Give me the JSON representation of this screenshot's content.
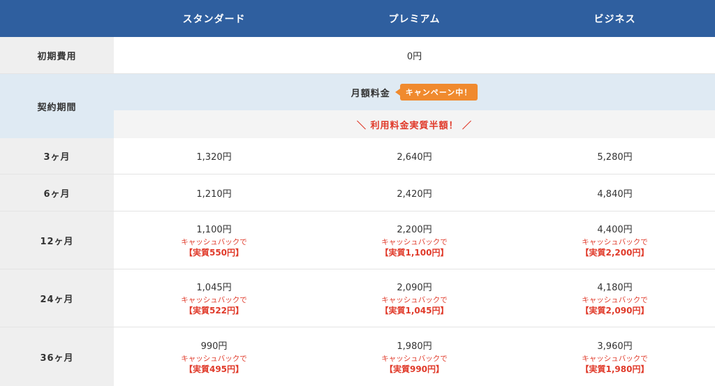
{
  "header": {
    "plans": [
      "スタンダード",
      "プレミアム",
      "ビジネス"
    ]
  },
  "initial_fee": {
    "label": "初期費用",
    "value": "0円"
  },
  "contract": {
    "label": "契約期間",
    "monthly_fee_label": "月額料金",
    "campaign_badge": "キャンペーン中！",
    "half_price_banner": "＼ 利用料金実質半額！ ／"
  },
  "rows": [
    {
      "period": "3ヶ月",
      "prices": [
        {
          "price": "1,320円"
        },
        {
          "price": "2,640円"
        },
        {
          "price": "5,280円"
        }
      ]
    },
    {
      "period": "6ヶ月",
      "prices": [
        {
          "price": "1,210円"
        },
        {
          "price": "2,420円"
        },
        {
          "price": "4,840円"
        }
      ]
    },
    {
      "period": "12ヶ月",
      "prices": [
        {
          "price": "1,100円",
          "cashback": "キャッシュバックで",
          "effective": "【実質550円】"
        },
        {
          "price": "2,200円",
          "cashback": "キャッシュバックで",
          "effective": "【実質1,100円】"
        },
        {
          "price": "4,400円",
          "cashback": "キャッシュバックで",
          "effective": "【実質2,200円】"
        }
      ]
    },
    {
      "period": "24ヶ月",
      "prices": [
        {
          "price": "1,045円",
          "cashback": "キャッシュバックで",
          "effective": "【実質522円】"
        },
        {
          "price": "2,090円",
          "cashback": "キャッシュバックで",
          "effective": "【実質1,045円】"
        },
        {
          "price": "4,180円",
          "cashback": "キャッシュバックで",
          "effective": "【実質2,090円】"
        }
      ]
    },
    {
      "period": "36ヶ月",
      "prices": [
        {
          "price": "990円",
          "cashback": "キャッシュバックで",
          "effective": "【実質495円】"
        },
        {
          "price": "1,980円",
          "cashback": "キャッシュバックで",
          "effective": "【実質990円】"
        },
        {
          "price": "3,960円",
          "cashback": "キャッシュバックで",
          "effective": "【実質1,980円】"
        }
      ]
    }
  ],
  "colors": {
    "header_bg": "#2f5f9f",
    "label_bg": "#efefef",
    "monthly_bg": "#dfeaf3",
    "accent_red": "#e03a2a",
    "badge_orange": "#f08a2e"
  }
}
